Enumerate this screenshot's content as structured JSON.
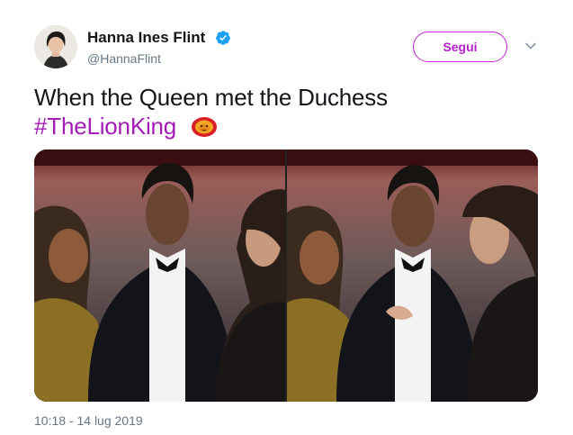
{
  "tweet": {
    "author": {
      "name": "Hanna Ines Flint",
      "handle": "@HannaFlint",
      "verified": true,
      "avatar_icon": "profile-photo"
    },
    "follow_label": "Segui",
    "more_icon": "chevron-down-icon",
    "text": "When the Queen met the Duchess",
    "hashtag": "#TheLionKing",
    "hashtag_emoji_icon": "lion-king-emoji-icon",
    "media": [
      {
        "icon": "photo-event-left"
      },
      {
        "icon": "photo-event-right"
      }
    ],
    "timestamp": "10:18 - 14 lug 2019"
  },
  "colors": {
    "accent": "#a21cb5",
    "verified_blue": "#1da1f2",
    "secondary_text": "#657786",
    "primary_text": "#14171a"
  }
}
